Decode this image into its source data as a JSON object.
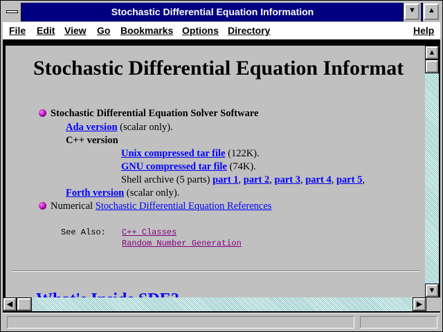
{
  "window": {
    "title": "Stochastic Differential Equation Information"
  },
  "menubar": {
    "items": [
      "File",
      "Edit",
      "View",
      "Go",
      "Bookmarks",
      "Options",
      "Directory"
    ],
    "help": "Help"
  },
  "page": {
    "heading": "Stochastic Differential Equation Informat",
    "software_heading": "Stochastic Differential Equation Solver Software",
    "ada_link": "Ada version",
    "ada_note": "(scalar only).",
    "cpp_heading": "C++ version",
    "unix_link": "Unix compressed tar file",
    "unix_note": "(122K).",
    "gnu_link": "GNU compressed tar file",
    "gnu_note": "(74K).",
    "shell_text": "Shell archive (5 parts)",
    "parts": [
      "part 1",
      "part 2",
      "part 3",
      "part 4",
      "part 5"
    ],
    "forth_link": "Forth version",
    "forth_note": "(scalar only).",
    "numerical_prefix": "Numerical",
    "references_link": "Stochastic Differential Equation References",
    "see_also_label": "See Also:",
    "see_also": [
      "C++ Classes",
      "Random Number Generation"
    ],
    "cut_off_heading": "What's Inside SDE?"
  },
  "colors": {
    "title_bar": "#000080",
    "link": "#0000ff",
    "visited_link": "#800080",
    "background": "#c0c0c0"
  }
}
